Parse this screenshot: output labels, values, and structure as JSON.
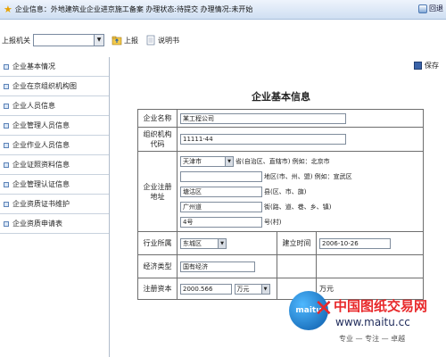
{
  "titlebar": {
    "title": "企业信息：外地建筑业企业进京施工备案 办理状态:待提交 办理情况:未开始",
    "back_label": "回退"
  },
  "toolbar": {
    "agency_label": "上报机关",
    "agency_value": "",
    "report_label": "上报",
    "manual_label": "说明书"
  },
  "sidebar": {
    "items": [
      {
        "label": "企业基本情况"
      },
      {
        "label": "企业在京组织机构图"
      },
      {
        "label": "企业人员信息"
      },
      {
        "label": "企业管理人员信息"
      },
      {
        "label": "企业作业人员信息"
      },
      {
        "label": "企业证照资料信息"
      },
      {
        "label": "企业管理认证信息"
      },
      {
        "label": "企业资质证书维护"
      },
      {
        "label": "企业资质申请表"
      }
    ]
  },
  "main": {
    "save_label": "保存",
    "form_title": "企业基本信息",
    "company_name_label": "企业名称",
    "company_name_value": "某工程公司",
    "org_code_label": "组织机构代码",
    "org_code_value": "11111-44",
    "address_label": "企业注册地址",
    "address": {
      "province_value": "天津市",
      "province_hint": "省(自治区、直辖市)  例如：北京市",
      "city_value": "",
      "city_hint": "地区(市、州、盟)  例如：宣武区",
      "county_value": "塘沽区",
      "county_hint": "县(区、市、旗)",
      "street_value": "广州道",
      "street_hint": "街(路、道、巷、乡、镇)",
      "number_value": "4号",
      "number_hint": "号(村)"
    },
    "industry_label": "行业所属",
    "industry_value": "东城区",
    "founded_label": "建立时间",
    "founded_value": "2006-10-26",
    "economy_label": "经济类型",
    "economy_value": "国有经济",
    "capital_label": "注册资本",
    "capital_value": "2000.566",
    "capital_unit_value": "万元",
    "capital_unit": "万元"
  },
  "watermark": {
    "logo_text": "maitu",
    "brand": "中国图纸交易网",
    "url": "www.maitu.cc",
    "slogan": "专业 — 专注 — 卓越"
  },
  "colors": {
    "titlebar_bg": "#cfdff2",
    "border": "#6e6e6e",
    "watermark_red": "#e8292b",
    "watermark_blue": "#0a5aa8"
  }
}
